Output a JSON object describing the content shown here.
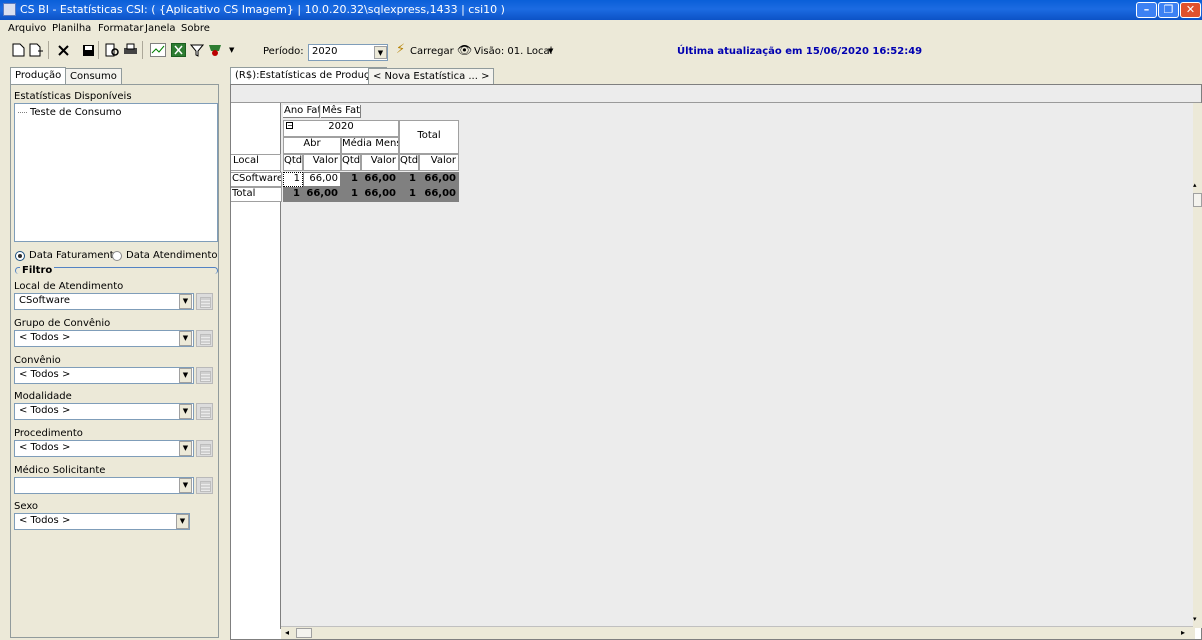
{
  "window": {
    "title": "CS BI - Estatísticas CSI: ( {Aplicativo CS Imagem} | 10.0.20.32\\sqlexpress,1433 | csi10 )",
    "minimize": "–",
    "maximize": "❐",
    "close": "✕"
  },
  "menu": [
    "Arquivo",
    "Planilha",
    "Formatar",
    "Janela",
    "Sobre"
  ],
  "toolbar": {
    "periodo_label": "Período:",
    "periodo_value": "2020",
    "carregar_label": "Carregar",
    "visao_label": "Visão: 01. Local",
    "last_update": "Última atualização em 15/06/2020 16:52:49",
    "icons": [
      "new-doc-icon",
      "new-sheet-icon",
      "delete-icon",
      "save-icon",
      "print-preview-icon",
      "print-icon",
      "chart-icon",
      "excel-icon",
      "filter-icon",
      "settings-icon"
    ]
  },
  "left_tabs": [
    "Produção",
    "Consumo"
  ],
  "stats": {
    "label": "Estatísticas Disponíveis",
    "items": [
      "Teste de Consumo"
    ]
  },
  "date_options": {
    "faturamento": "Data Faturamento",
    "atendimento": "Data Atendimento",
    "selected": "faturamento"
  },
  "filtro_label": "Filtro",
  "filters": [
    {
      "label": "Local de Atendimento",
      "value": "CSoftware"
    },
    {
      "label": "Grupo de Convênio",
      "value": "< Todos >"
    },
    {
      "label": "Convênio",
      "value": "< Todos >"
    },
    {
      "label": "Modalidade",
      "value": "< Todos >"
    },
    {
      "label": "Procedimento",
      "value": "< Todos >"
    },
    {
      "label": "Médico Solicitante",
      "value": ""
    }
  ],
  "sexo": {
    "label": "Sexo",
    "value": "< Todos >"
  },
  "doc_tabs": [
    "(R$):Estatísticas de Produção",
    "< Nova Estatística ... >"
  ],
  "pivot": {
    "col_fields": [
      "Ano Fat.",
      "Mês Fat."
    ],
    "row_field": "Local",
    "year": "2020",
    "total_header": "Total",
    "months": [
      "Abr",
      "Média Mensal"
    ],
    "measures": [
      "Qtde",
      "Valor"
    ],
    "rows": [
      {
        "label": "CSoftware",
        "values": [
          "1",
          "66,00",
          "1",
          "66,00",
          "1",
          "66,00"
        ]
      },
      {
        "label": "Total",
        "values": [
          "1",
          "66,00",
          "1",
          "66,00",
          "1",
          "66,00"
        ]
      }
    ]
  }
}
